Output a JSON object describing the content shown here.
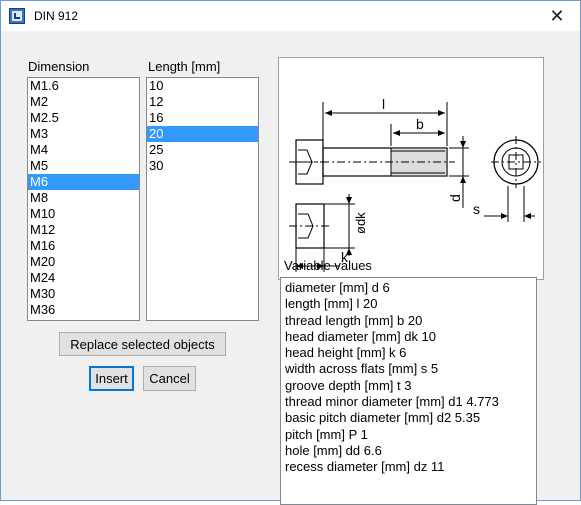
{
  "window": {
    "title": "DIN 912",
    "close_glyph": "✕"
  },
  "dimension": {
    "label": "Dimension",
    "selected": "M6",
    "items": [
      "M1.6",
      "M2",
      "M2.5",
      "M3",
      "M4",
      "M5",
      "M6",
      "M8",
      "M10",
      "M12",
      "M16",
      "M20",
      "M24",
      "M30",
      "M36"
    ]
  },
  "length": {
    "label": "Length [mm]",
    "selected": "20",
    "items": [
      "10",
      "12",
      "16",
      "20",
      "25",
      "30"
    ]
  },
  "buttons": {
    "replace": "Replace selected objects",
    "insert": "Insert",
    "cancel": "Cancel"
  },
  "drawing": {
    "l": "l",
    "b": "b",
    "d": "d",
    "s": "s",
    "dk": "ødk",
    "k": "k"
  },
  "variables": {
    "label": "Variable values",
    "lines": [
      "diameter [mm] d 6",
      "length [mm] l 20",
      "thread length [mm] b 20",
      "head diameter [mm] dk 10",
      "head height [mm] k 6",
      "width across flats [mm] s 5",
      "groove depth [mm] t 3",
      "thread minor diameter [mm] d1 4.773",
      "basic pitch diameter [mm] d2 5.35",
      "pitch [mm] P 1",
      "hole [mm] dd 6.6",
      "recess diameter [mm] dz 11"
    ]
  }
}
